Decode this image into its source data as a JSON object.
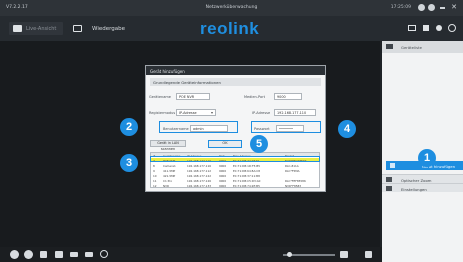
{
  "titlebar": {
    "version": "V7.2.2.17",
    "title": "Netzwerküberwachung",
    "clock": "17:25:09"
  },
  "nav": {
    "live_label": "Live-Ansicht",
    "playback_label": "Wiedergabe",
    "logo": "reolink"
  },
  "sidebar": {
    "header_label": "Geräteliste",
    "add_device_label": "Gerät hinzufügen",
    "rows": [
      {
        "label": "Optischer Zoom"
      },
      {
        "label": "Einstellungen"
      }
    ]
  },
  "dialog": {
    "title": "Gerät hinzufügen",
    "section": "Grundlegende Geräteinformationen",
    "device_name_label": "Gerätename",
    "device_name_value": "POE NVR",
    "media_port_label": "Medien-Port",
    "media_port_value": "9000",
    "register_mode_label": "Registermodus",
    "register_mode_value": "IP-Adresse",
    "ip_label": "IP-Adresse",
    "ip_value": "192.168.177.110",
    "username_label": "Benutzername",
    "username_value": "admin",
    "password_label": "Passwort",
    "password_value": "•••••••",
    "scan_lan_label": "Gerät in LAN scannen",
    "ok_label": "OK",
    "table_columns": [
      "#",
      "Gerätename",
      "IP-Adresse",
      "Port",
      "Mac-Adresse",
      "Modell"
    ],
    "table_rows": [
      [
        "7",
        "POE NVR",
        "192.168.177.110",
        "9000",
        "EC:71:DB:74:2E:F1",
        "NVR*FNV8MWS"
      ],
      [
        "8",
        "Camera1",
        "192.168.177.116",
        "9000",
        "EC:71:DB:1D:F5:B5",
        "RLC-811A"
      ],
      [
        "9",
        "411-5MP",
        "192.168.177.112",
        "9000",
        "EC:71:DB:64:8A:C8",
        "RLC*F5MA"
      ],
      [
        "10",
        "421-5MP",
        "192.168.177.122",
        "9000",
        "EC:71:DB:37:11:B8",
        ""
      ],
      [
        "11",
        "C1 Pro",
        "192.168.177.126",
        "9000",
        "EC:71:DB:C5:D3:A0",
        "RLC*FEF85586"
      ],
      [
        "12",
        "NVR",
        "192.168.177.133",
        "9000",
        "EC:71:DB:74:2E:B5",
        "NVR*F8583"
      ]
    ]
  },
  "callouts": [
    "1",
    "2",
    "3",
    "4",
    "5"
  ],
  "colors": {
    "accent": "#1e8ee0",
    "selected_row": "#e9ef45"
  }
}
